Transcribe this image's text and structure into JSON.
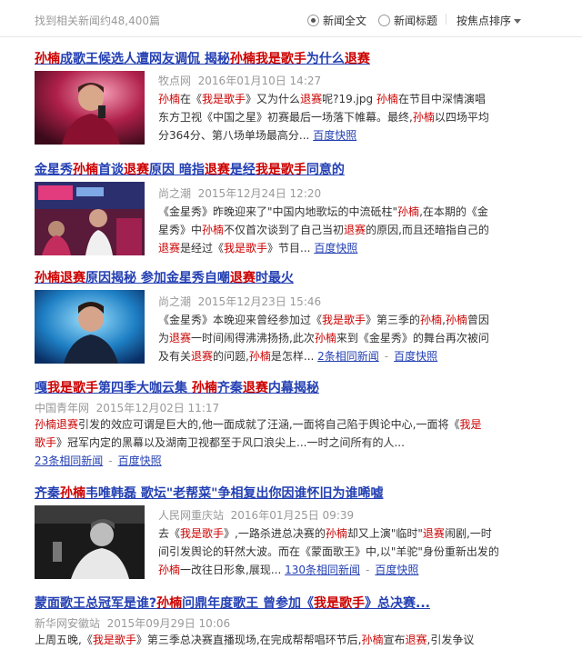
{
  "header": {
    "result_count": "找到相关新闻约48,400篇",
    "option_fulltext": "新闻全文",
    "option_title": "新闻标题",
    "sort_label": "按焦点排序"
  },
  "cached_label": "百度快照",
  "results": [
    {
      "title_parts": [
        [
          "孙楠",
          "hl"
        ],
        [
          "成歌王候选人遭网友调侃 揭秘",
          ""
        ],
        [
          "孙楠",
          "hl"
        ],
        [
          "我是歌手",
          "hl"
        ],
        [
          "为什么",
          ""
        ],
        [
          "退赛",
          "hl"
        ]
      ],
      "source": "牧点网",
      "date": "2016年01月10日 14:27",
      "snippet_lines": [
        [
          [
            "孙楠",
            "hl"
          ],
          [
            "在《",
            ""
          ],
          [
            "我是歌手",
            "hl"
          ],
          [
            "》又为什么",
            ""
          ],
          [
            "退赛",
            "hl"
          ],
          [
            "呢?19.jpg ",
            ""
          ],
          [
            "孙楠",
            "hl"
          ],
          [
            "在节目中深情演唱",
            ""
          ]
        ],
        [
          [
            "东方卫视《中国之星》初赛最后一场落下帷幕。最终,",
            ""
          ],
          [
            "孙楠",
            "hl"
          ],
          [
            "以四场平均",
            ""
          ]
        ],
        [
          [
            "分364分、第八场单场最高分...",
            ""
          ]
        ]
      ]
    },
    {
      "title_parts": [
        [
          "金星秀",
          ""
        ],
        [
          "孙楠",
          "hl"
        ],
        [
          "首谈",
          ""
        ],
        [
          "退赛",
          "hl"
        ],
        [
          "原因 暗指",
          ""
        ],
        [
          "退赛",
          "hl"
        ],
        [
          "是经",
          ""
        ],
        [
          "我是歌手",
          "hl"
        ],
        [
          "同意的",
          ""
        ]
      ],
      "source": "尚之潮",
      "date": "2015年12月24日 12:20",
      "snippet_lines": [
        [
          [
            "《金星秀》昨晚迎来了\"中国内地歌坛的中流砥柱\"",
            ""
          ],
          [
            "孙楠",
            "hl"
          ],
          [
            ",在本期的《金",
            ""
          ]
        ],
        [
          [
            "星秀》中",
            ""
          ],
          [
            "孙楠",
            "hl"
          ],
          [
            "不仅首次谈到了自己当初",
            ""
          ],
          [
            "退赛",
            "hl"
          ],
          [
            "的原因,而且还暗指自己的",
            ""
          ]
        ],
        [
          [
            "退赛",
            "hl"
          ],
          [
            "是经过《",
            ""
          ],
          [
            "我是歌手",
            "hl"
          ],
          [
            "》节目...",
            ""
          ]
        ]
      ]
    },
    {
      "title_parts": [
        [
          "孙楠",
          "hl"
        ],
        [
          "退赛",
          "hl"
        ],
        [
          "原因揭秘 参加金星秀自嘲",
          ""
        ],
        [
          "退赛",
          "hl"
        ],
        [
          "时最火",
          ""
        ]
      ],
      "source": "尚之潮",
      "date": "2015年12月23日 15:46",
      "snippet_lines": [
        [
          [
            "《金星秀》本晚迎来曾经参加过《",
            ""
          ],
          [
            "我是歌手",
            "hl"
          ],
          [
            "》第三季的",
            ""
          ],
          [
            "孙楠",
            "hl"
          ],
          [
            ",",
            ""
          ],
          [
            "孙楠",
            "hl"
          ],
          [
            "曾因",
            ""
          ]
        ],
        [
          [
            "为",
            ""
          ],
          [
            "退赛",
            "hl"
          ],
          [
            "一时间闹得沸沸扬扬,此次",
            ""
          ],
          [
            "孙楠",
            "hl"
          ],
          [
            "来到《金星秀》的舞台再次被问",
            ""
          ]
        ],
        [
          [
            "及有关",
            ""
          ],
          [
            "退赛",
            "hl"
          ],
          [
            "的问题,",
            ""
          ],
          [
            "孙楠",
            "hl"
          ],
          [
            "是怎样...",
            ""
          ]
        ]
      ],
      "related": "2条相同新闻"
    },
    {
      "title_parts": [
        [
          "嘎",
          ""
        ],
        [
          "我是歌手",
          "hl"
        ],
        [
          "第四季大咖云集 ",
          ""
        ],
        [
          "孙楠",
          "hl"
        ],
        [
          "齐秦",
          ""
        ],
        [
          "退赛",
          "hl"
        ],
        [
          "内幕揭秘",
          ""
        ]
      ],
      "source": "中国青年网",
      "date": "2015年12月02日 11:17",
      "snippet_lines": [
        [
          [
            "孙楠",
            "hl"
          ],
          [
            "退赛",
            "hl"
          ],
          [
            "引发的效应可谓是巨大的,他一面成就了汪涵,一面将自己陷于舆论中心,一面将《",
            ""
          ],
          [
            "我是",
            "hl"
          ]
        ],
        [
          [
            "歌手",
            "hl"
          ],
          [
            "》冠军内定的黑幕以及湖南卫视都至于风口浪尖上...一时之间所有的人...",
            ""
          ]
        ]
      ],
      "related": "23条相同新闻"
    },
    {
      "title_parts": [
        [
          "齐秦",
          ""
        ],
        [
          "孙楠",
          "hl"
        ],
        [
          "韦唯韩磊 歌坛\"老帮菜\"争相复出你因谁怀旧为谁唏嘘",
          ""
        ]
      ],
      "source": "人民网重庆站",
      "date": "2016年01月25日 09:39",
      "snippet_lines": [
        [
          [
            "去《",
            ""
          ],
          [
            "我是歌手",
            "hl"
          ],
          [
            "》,一路杀进总决赛的",
            ""
          ],
          [
            "孙楠",
            "hl"
          ],
          [
            "却又上演\"临时\"",
            ""
          ],
          [
            "退赛",
            "hl"
          ],
          [
            "闹剧,一时",
            ""
          ]
        ],
        [
          [
            "间引发舆论的轩然大波。而在《蒙面歌王》中,以\"羊驼\"身份重新出发的",
            ""
          ]
        ],
        [
          [
            "孙楠",
            "hl"
          ],
          [
            "一改往日形象,展现...",
            ""
          ]
        ]
      ],
      "related": "130条相同新闻"
    },
    {
      "title_parts": [
        [
          "蒙面歌王总冠军是谁?",
          ""
        ],
        [
          "孙楠",
          "hl"
        ],
        [
          "问鼎年度歌王 曾参加《",
          ""
        ],
        [
          "我是歌手",
          "hl"
        ],
        [
          "》总决赛...",
          ""
        ]
      ],
      "source": "新华网安徽站",
      "date": "2015年09月29日 10:06",
      "snippet_lines": [
        [
          [
            "上周五晚,《",
            ""
          ],
          [
            "我是歌手",
            "hl"
          ],
          [
            "》第三季总决赛直播现场,在完成帮帮唱环节后,",
            ""
          ],
          [
            "孙楠",
            "hl"
          ],
          [
            "宣布",
            ""
          ],
          [
            "退赛",
            "hl"
          ],
          [
            ",引发争议",
            ""
          ]
        ]
      ]
    }
  ]
}
